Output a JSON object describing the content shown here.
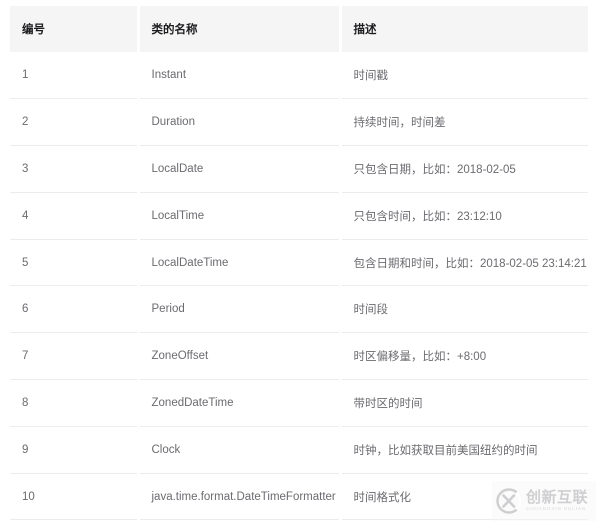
{
  "table": {
    "columns": [
      {
        "key": "num",
        "label": "编号"
      },
      {
        "key": "name",
        "label": "类的名称"
      },
      {
        "key": "desc",
        "label": "描述"
      }
    ],
    "rows": [
      {
        "num": "1",
        "name": "Instant",
        "desc": "时间戳"
      },
      {
        "num": "2",
        "name": "Duration",
        "desc": "持续时间，时间差"
      },
      {
        "num": "3",
        "name": "LocalDate",
        "desc": "只包含日期，比如：2018-02-05"
      },
      {
        "num": "4",
        "name": "LocalTime",
        "desc": "只包含时间，比如：23:12:10"
      },
      {
        "num": "5",
        "name": "LocalDateTime",
        "desc": "包含日期和时间，比如：2018-02-05 23:14:21"
      },
      {
        "num": "6",
        "name": "Period",
        "desc": "时间段"
      },
      {
        "num": "7",
        "name": "ZoneOffset",
        "desc": "时区偏移量，比如：+8:00"
      },
      {
        "num": "8",
        "name": "ZonedDateTime",
        "desc": "带时区的时间"
      },
      {
        "num": "9",
        "name": "Clock",
        "desc": "时钟，比如获取目前美国纽约的时间"
      },
      {
        "num": "10",
        "name": "java.time.format.DateTimeFormatter",
        "desc": "时间格式化"
      }
    ]
  },
  "watermark": {
    "brand": "创新互联",
    "subtitle": "CHUANGXIN HULIAN"
  },
  "colors": {
    "header_bg": "#f5f5f6",
    "row_bg": "#ffffff",
    "header_text": "#1d1d1f",
    "body_text": "#6b6b70",
    "row_divider": "#ececed",
    "column_gap": "#ffffff"
  }
}
